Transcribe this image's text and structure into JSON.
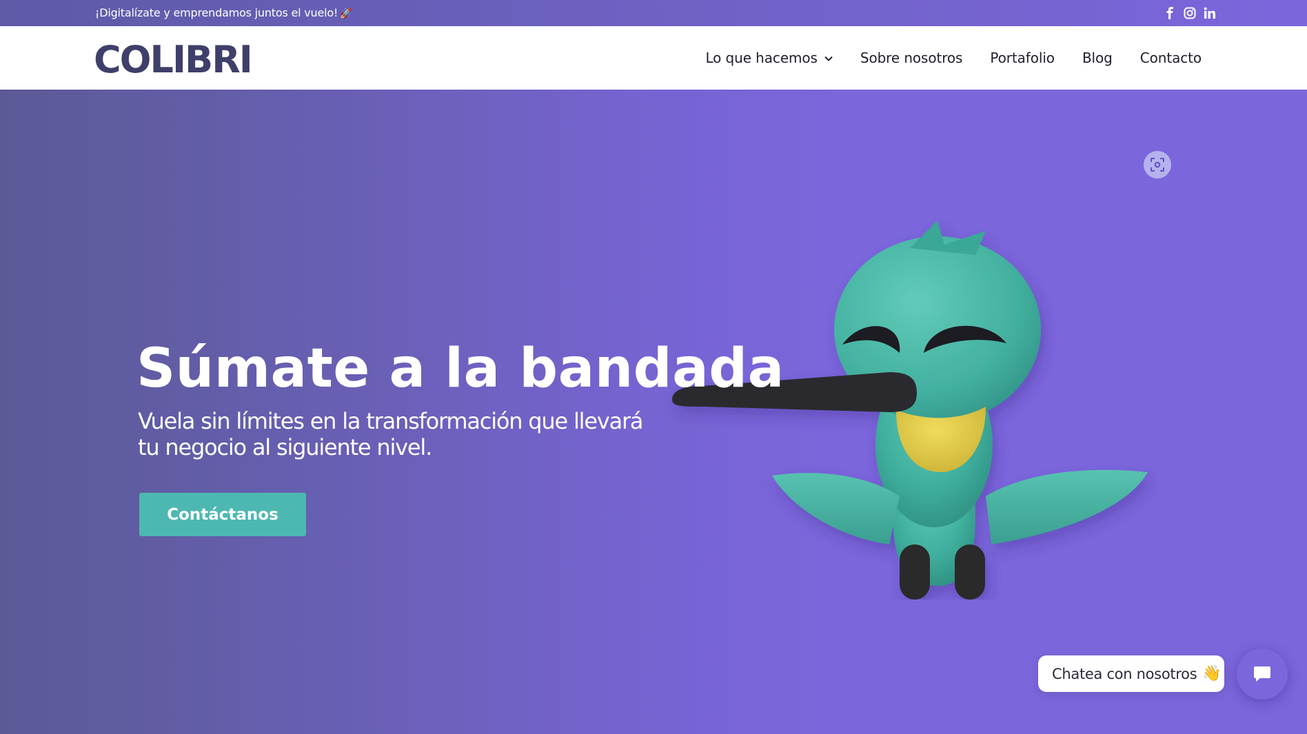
{
  "topbar": {
    "promo": "¡Digitalízate y emprendamos juntos el vuelo!",
    "promo_emoji": "🚀",
    "social": [
      {
        "icon": "facebook-icon",
        "glyph": "f"
      },
      {
        "icon": "instagram-icon"
      },
      {
        "icon": "linkedin-icon",
        "glyph": "in"
      }
    ]
  },
  "header": {
    "logo_text": "COLIBRI",
    "nav": [
      {
        "label": "Lo que hacemos",
        "dropdown": true
      },
      {
        "label": "Sobre nosotros"
      },
      {
        "label": "Portafolio"
      },
      {
        "label": "Blog"
      },
      {
        "label": "Contacto"
      }
    ]
  },
  "hero": {
    "title": "Súmate a la bandada",
    "subtitle": "Vuela sin límites en la transformación que llevará tu negocio al siguiente nivel.",
    "cta_label": "Contáctanos"
  },
  "chat": {
    "label": "Chatea con nosotros",
    "emoji": "👋"
  },
  "colors": {
    "brand_purple": "#7b66dc",
    "teal": "#4db8b1",
    "logo_navy": "#3f3f6b"
  }
}
